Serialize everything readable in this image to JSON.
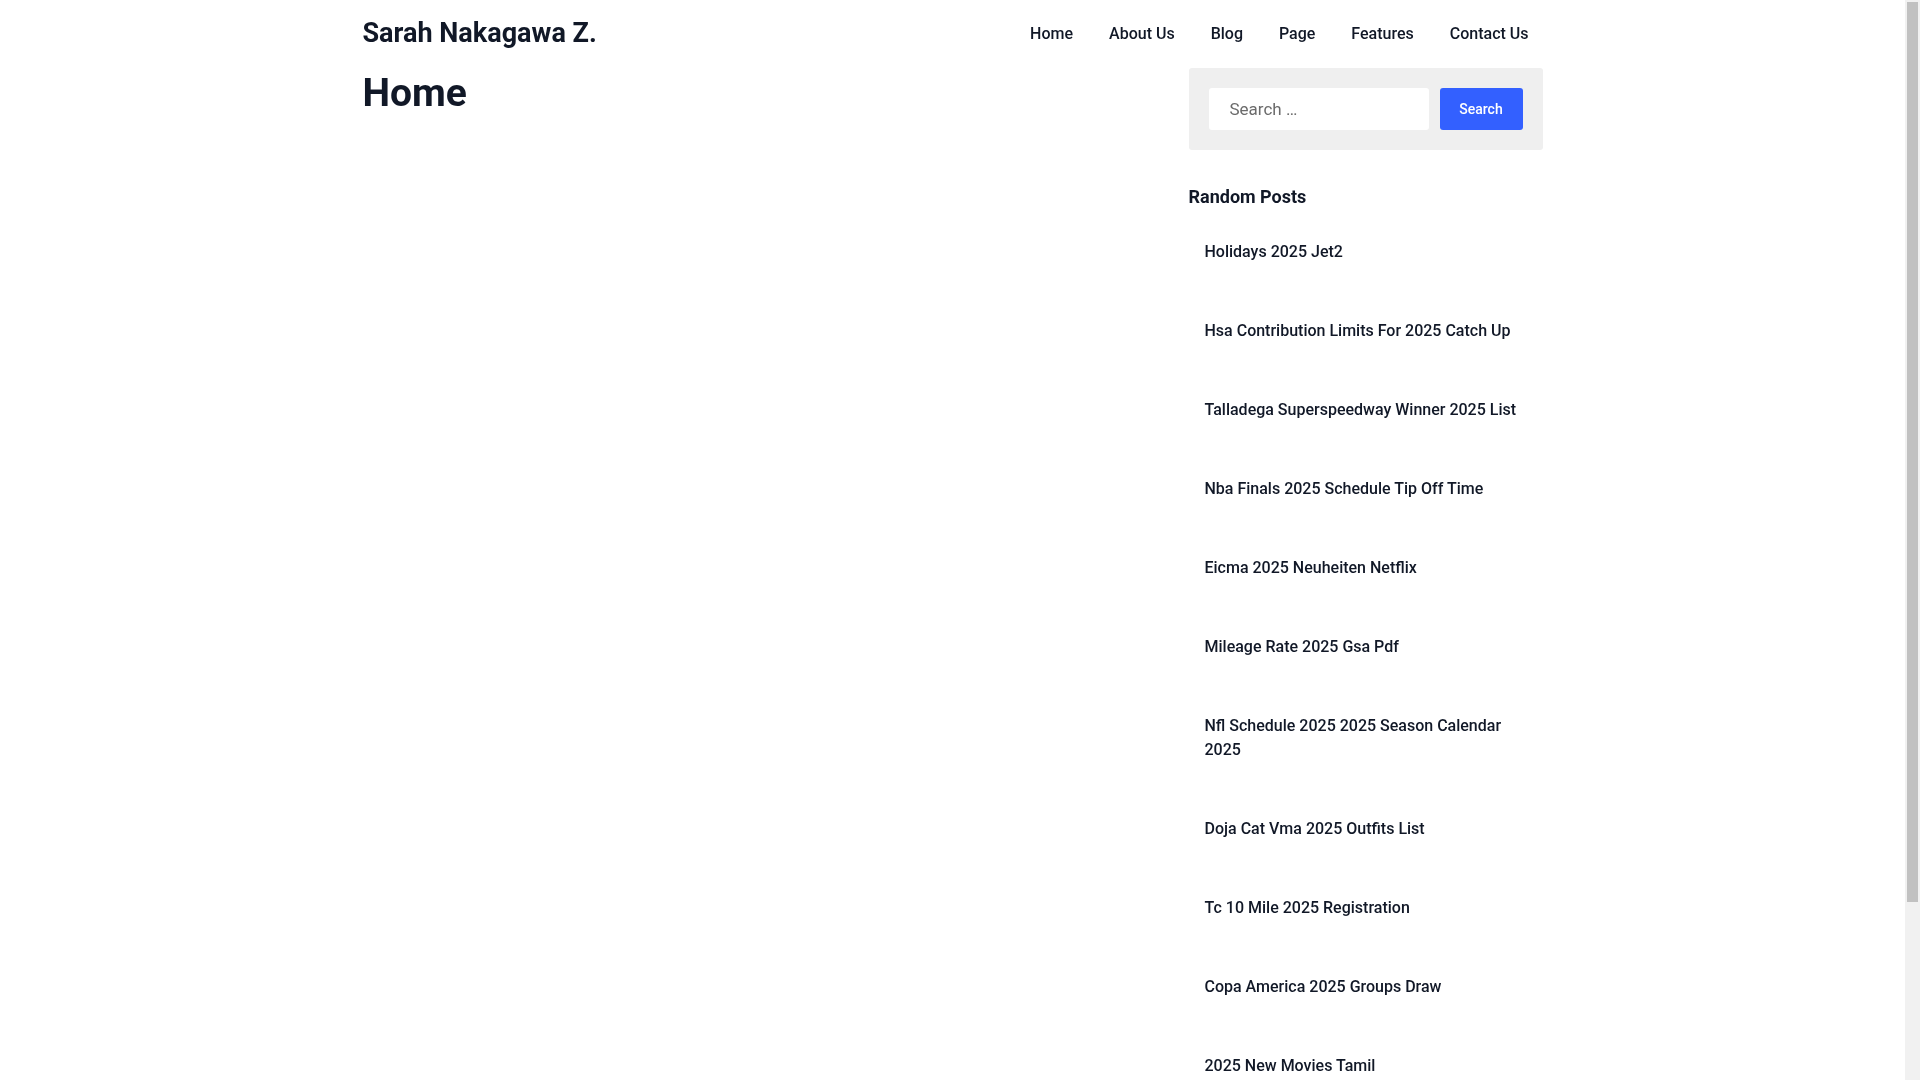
{
  "site_title": "Sarah Nakagawa Z.",
  "nav": [
    "Home",
    "About Us",
    "Blog",
    "Page",
    "Features",
    "Contact Us"
  ],
  "page_title": "Home",
  "search": {
    "placeholder": "Search …",
    "button": "Search"
  },
  "random_posts": {
    "title": "Random Posts",
    "items": [
      "Holidays 2025 Jet2",
      "Hsa Contribution Limits For 2025 Catch Up",
      "Talladega Superspeedway Winner 2025 List",
      "Nba Finals 2025 Schedule Tip Off Time",
      "Eicma 2025 Neuheiten Netflix",
      "Mileage Rate 2025 Gsa Pdf",
      "Nfl Schedule 2025 2025 Season Calendar 2025",
      "Doja Cat Vma 2025 Outfits List",
      "Tc 10 Mile 2025 Registration",
      "Copa America 2025 Groups Draw",
      "2025 New Movies Tamil"
    ]
  }
}
